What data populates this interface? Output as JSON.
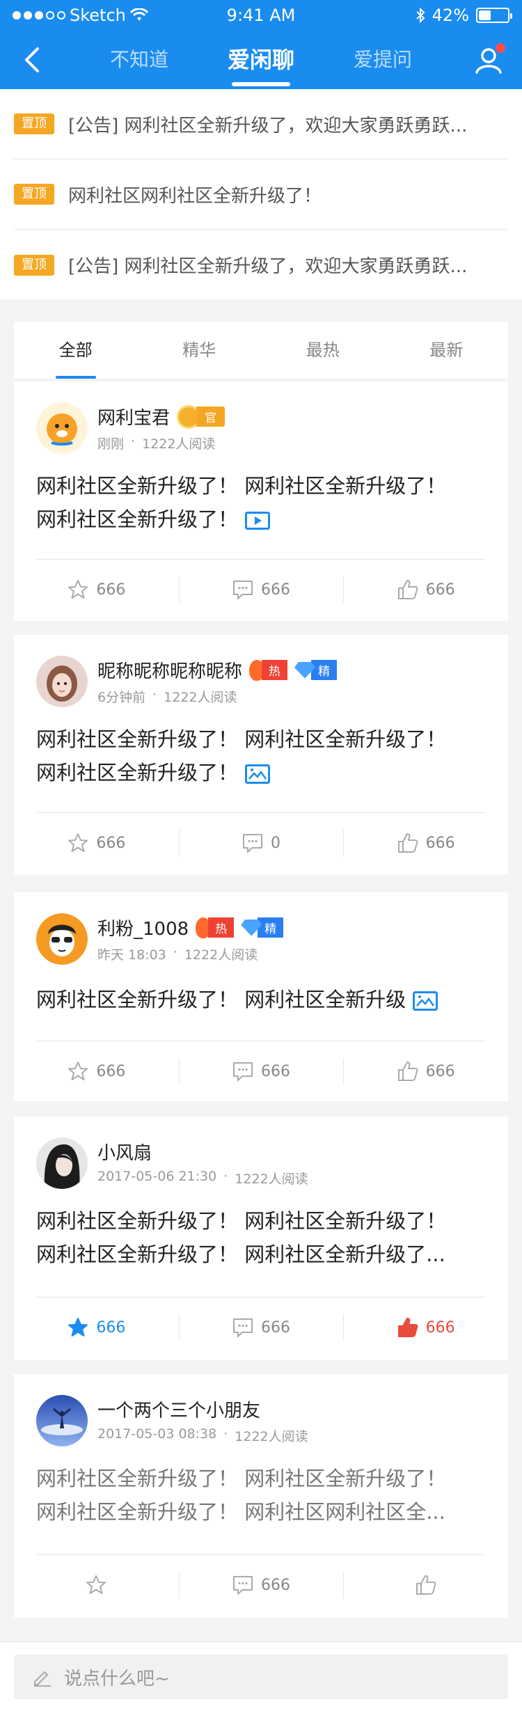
{
  "status_bar": {
    "carrier": "Sketch",
    "time": "9:41 AM",
    "battery": "42%",
    "battery_level": 0.42
  },
  "nav": {
    "tabs": [
      "不知道",
      "爱闲聊",
      "爱提问"
    ],
    "active_tab": 1
  },
  "pinned": [
    {
      "badge": "置顶",
      "text": "[公告] 网利社区全新升级了，欢迎大家勇跃勇跃..."
    },
    {
      "badge": "置顶",
      "text": "网利社区网利社区全新升级了！"
    },
    {
      "badge": "置顶",
      "text": "[公告] 网利社区全新升级了，欢迎大家勇跃勇跃..."
    }
  ],
  "sort_tabs": [
    "全部",
    "精华",
    "最热",
    "最新"
  ],
  "posts": [
    {
      "name": "网利宝君",
      "time": "刚刚",
      "reads": "1222人阅读",
      "badges": {
        "official": "官"
      },
      "content": [
        "网利社区全新升级了！ 网利社区全新升级了！",
        "网利社区全新升级了！"
      ],
      "content_icon": "video-icon",
      "actions": {
        "fav": "666",
        "comment": "666",
        "like": "666"
      }
    },
    {
      "name": "昵称昵称昵称昵称",
      "time": "6分钟前",
      "reads": "1222人阅读",
      "badges": {
        "hot": "热",
        "essence": "精"
      },
      "content": [
        "网利社区全新升级了！ 网利社区全新升级了！",
        "网利社区全新升级了！"
      ],
      "content_icon": "image-icon",
      "actions": {
        "fav": "666",
        "comment": "0",
        "like": "666"
      }
    },
    {
      "name": "利粉_1008",
      "time": "昨天 18:03",
      "reads": "1222人阅读",
      "badges": {
        "hot": "热",
        "essence": "精"
      },
      "content": [
        "网利社区全新升级了！ 网利社区全新升级"
      ],
      "content_icon": "image-icon",
      "actions": {
        "fav": "666",
        "comment": "666",
        "like": "666"
      }
    },
    {
      "name": "小风扇",
      "time": "2017-05-06 21:30",
      "reads": "1222人阅读",
      "content": [
        "网利社区全新升级了！ 网利社区全新升级了！",
        "网利社区全新升级了！ 网利社区全新升级了..."
      ],
      "actions": {
        "fav": "666",
        "comment": "666",
        "like": "666"
      }
    },
    {
      "name": "一个两个三个小朋友",
      "time": "2017-05-03 08:38",
      "reads": "1222人阅读",
      "content": [
        "网利社区全新升级了！ 网利社区全新升级了！",
        "网利社区全新升级了！ 网利社区网利社区全..."
      ],
      "actions": {
        "comment": "666"
      }
    }
  ],
  "composer": {
    "placeholder": "说点什么吧~"
  },
  "colors": {
    "brand_blue": "#1a8cf0",
    "pin_orange": "#f5a623",
    "like_red": "#e94b3c"
  }
}
